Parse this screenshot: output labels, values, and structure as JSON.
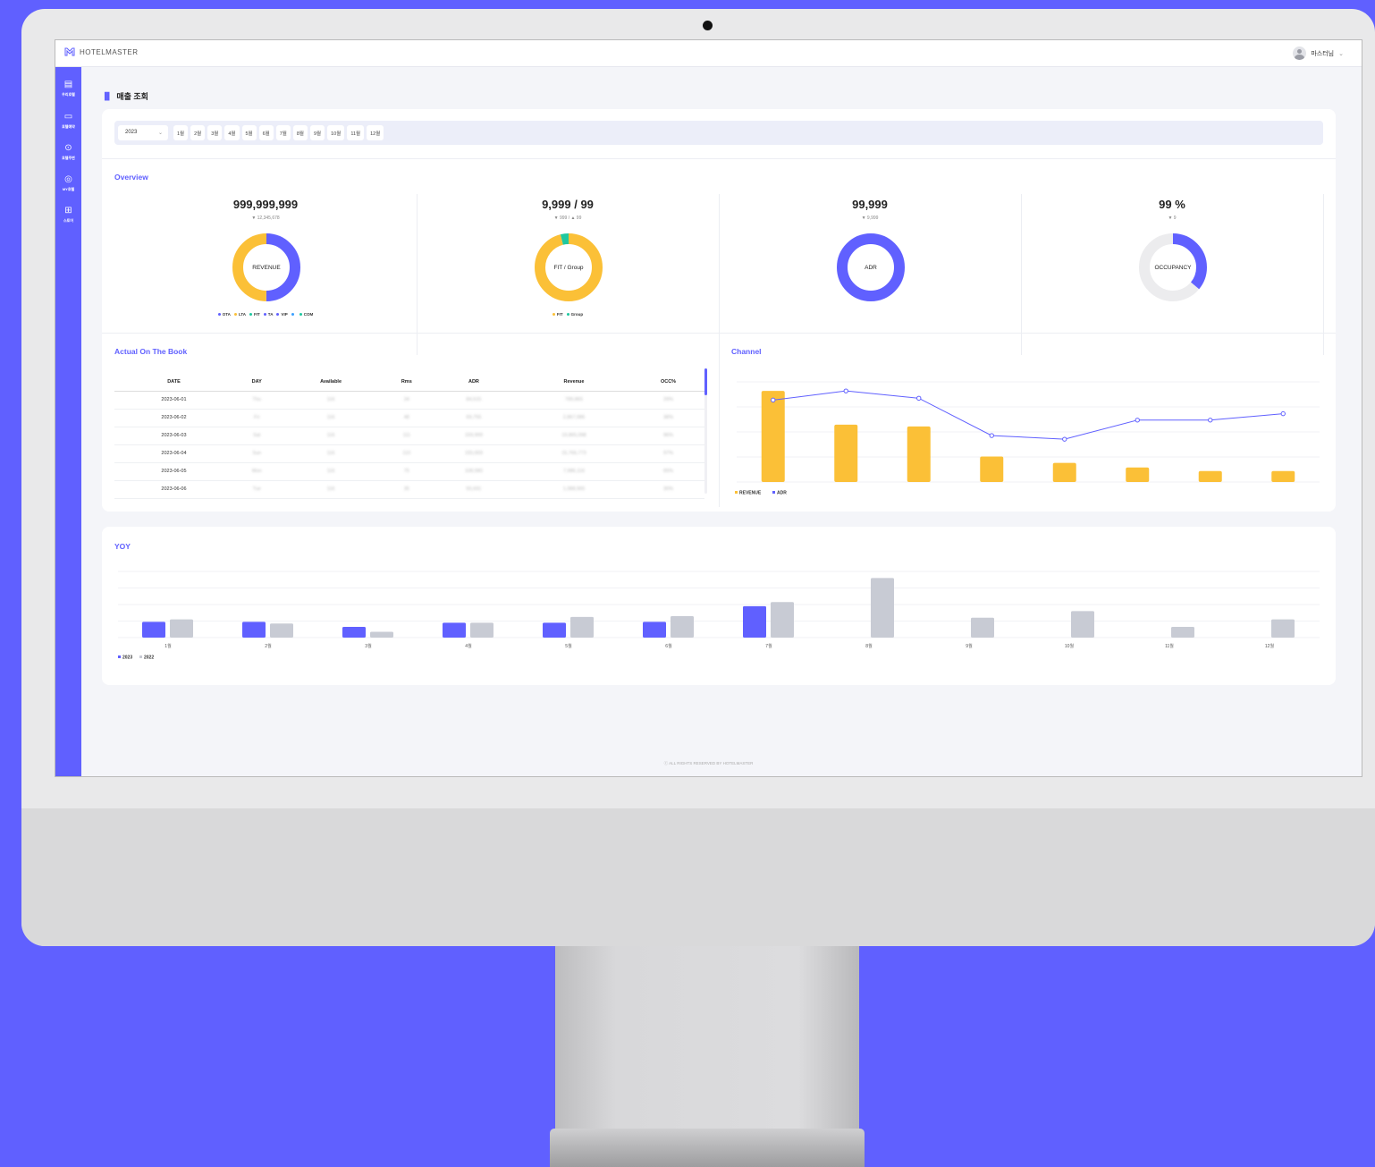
{
  "app": {
    "brand": "HOTELMASTER",
    "user_name": "마스터님"
  },
  "sidebar": {
    "items": [
      {
        "icon": "building-icon",
        "label": "우리호텔"
      },
      {
        "icon": "calendar-icon",
        "label": "호텔예약"
      },
      {
        "icon": "location-pin-icon",
        "label": "호텔주변"
      },
      {
        "icon": "user-circle-icon",
        "label": "MY호텔"
      },
      {
        "icon": "store-icon",
        "label": "스토어"
      }
    ]
  },
  "page": {
    "title": "매출 조회"
  },
  "filter": {
    "year": "2023",
    "months": [
      "1월",
      "2월",
      "3월",
      "4월",
      "5월",
      "6월",
      "7월",
      "8월",
      "9월",
      "10월",
      "11월",
      "12월"
    ]
  },
  "overview": {
    "title": "Overview",
    "kpis": [
      {
        "value": "999,999,999",
        "delta": "▼ 12,345,678",
        "label": "REVENUE",
        "legend": [
          {
            "name": "OTA",
            "color": "#6060ff"
          },
          {
            "name": "LTA",
            "color": "#fbc037"
          },
          {
            "name": "FIT",
            "color": "#1ec8a0"
          },
          {
            "name": "TA",
            "color": "#6060ff"
          },
          {
            "name": "VIP",
            "color": "#6060ff"
          },
          {
            "name": "",
            "color": "#3aa0ff"
          },
          {
            "name": "COM",
            "color": "#1ec8a0"
          }
        ],
        "segments": [
          {
            "value": 50,
            "color": "#6060ff"
          },
          {
            "value": 50,
            "color": "#fbc037"
          }
        ]
      },
      {
        "value": "9,999 / 99",
        "delta": "▼ 999 / ▲ 99",
        "label": "FIT / Group",
        "legend": [
          {
            "name": "FIT",
            "color": "#fbc037"
          },
          {
            "name": "Group",
            "color": "#1ec8a0"
          }
        ],
        "segments": [
          {
            "value": 96,
            "color": "#fbc037"
          },
          {
            "value": 4,
            "color": "#1ec8a0"
          }
        ]
      },
      {
        "value": "99,999",
        "delta": "▼ 9,999",
        "label": "ADR",
        "legend": [],
        "segments": [
          {
            "value": 100,
            "color": "#6060ff"
          }
        ]
      },
      {
        "value": "99 %",
        "delta": "▼ 9",
        "label": "OCCUPANCY",
        "legend": [],
        "segments": [
          {
            "value": 36,
            "color": "#6060ff"
          },
          {
            "value": 64,
            "color": "#ececee"
          }
        ]
      }
    ]
  },
  "aotb": {
    "title": "Actual On The Book",
    "columns": [
      "DATE",
      "DAY",
      "Available",
      "Rms",
      "ADR",
      "Revenue",
      "OCC%"
    ],
    "rows": [
      [
        "2023-06-01",
        "Thu",
        "116",
        "34",
        "84,515",
        "789,865",
        "29%"
      ],
      [
        "2023-06-02",
        "Fri",
        "116",
        "48",
        "69,755",
        "2,867,986",
        "38%"
      ],
      [
        "2023-06-03",
        "Sat",
        "116",
        "111",
        "159,999",
        "19,865,098",
        "96%"
      ],
      [
        "2023-06-04",
        "Sun",
        "116",
        "110",
        "155,659",
        "15,766,773",
        "97%"
      ],
      [
        "2023-06-05",
        "Mon",
        "116",
        "75",
        "108,580",
        "7,986,116",
        "65%"
      ],
      [
        "2023-06-06",
        "Tue",
        "116",
        "35",
        "55,691",
        "1,088,965",
        "30%"
      ]
    ]
  },
  "channel": {
    "title": "Channel",
    "chart_data": {
      "type": "bar",
      "series": [
        {
          "name": "REVENUE",
          "color": "#fbc037",
          "values": [
            100,
            63,
            61,
            28,
            21,
            16,
            12,
            12
          ]
        },
        {
          "name": "ADR",
          "color": "#6060ff",
          "values": [
            90,
            100,
            92,
            51,
            47,
            68,
            68,
            75
          ]
        }
      ],
      "ylim": [
        0,
        110
      ],
      "grid": true,
      "legend": "bottom-left"
    }
  },
  "yoy": {
    "title": "YOY",
    "chart_data": {
      "type": "bar",
      "categories": [
        "1월",
        "2월",
        "3월",
        "4월",
        "5월",
        "6월",
        "7월",
        "8월",
        "9월",
        "10월",
        "11월",
        "12월"
      ],
      "series": [
        {
          "name": "2023",
          "color": "#6060ff",
          "values": [
            19,
            19,
            13,
            18,
            18,
            19,
            38,
            null,
            null,
            null,
            null,
            null
          ]
        },
        {
          "name": "2022",
          "color": "#c8cbd4",
          "values": [
            22,
            17,
            7,
            18,
            25,
            26,
            43,
            72,
            24,
            32,
            13,
            22
          ]
        }
      ],
      "ylim": [
        0,
        80
      ],
      "grid": true,
      "legend": "bottom-left"
    }
  },
  "footer": {
    "text": "ⓒ ALL RIGHTS RESERVED BY HOTELMASTER"
  }
}
